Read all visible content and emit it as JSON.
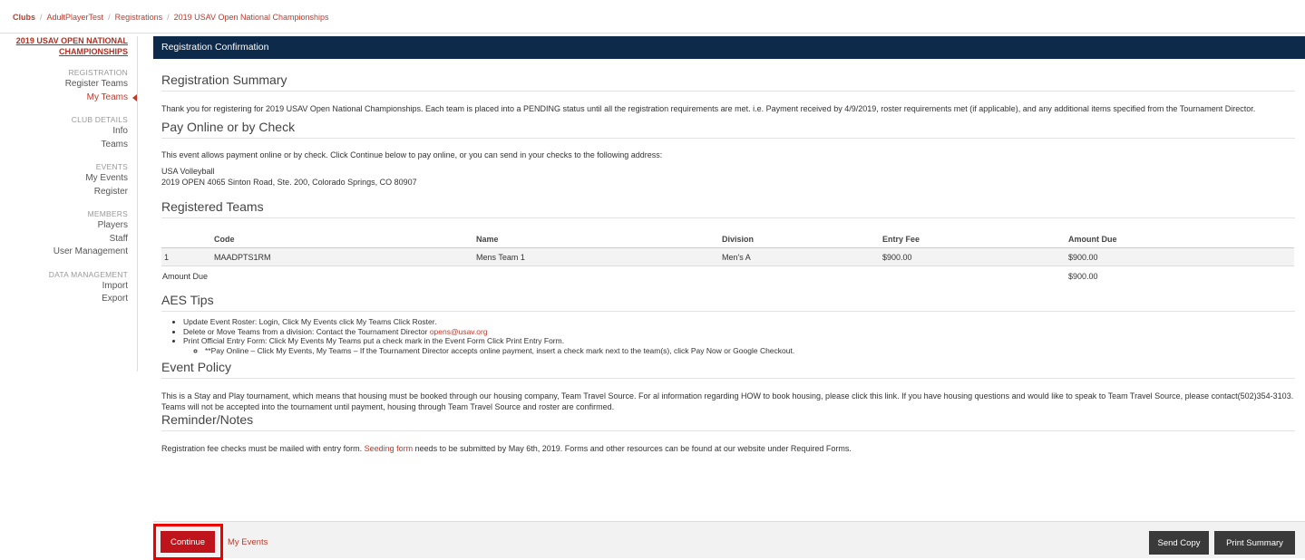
{
  "breadcrumb": [
    "Clubs",
    "AdultPlayerTest",
    "Registrations",
    "2019 USAV Open National Championships"
  ],
  "sidebar": {
    "event_title": "2019 USAV OPEN NATIONAL CHAMPIONSHIPS",
    "sections": [
      {
        "title": "REGISTRATION",
        "items": [
          "Register Teams",
          "My Teams"
        ]
      },
      {
        "title": "CLUB DETAILS",
        "items": [
          "Info",
          "Teams"
        ]
      },
      {
        "title": "EVENTS",
        "items": [
          "My Events",
          "Register"
        ]
      },
      {
        "title": "MEMBERS",
        "items": [
          "Players",
          "Staff",
          "User Management"
        ]
      },
      {
        "title": "DATA MANAGEMENT",
        "items": [
          "Import",
          "Export"
        ]
      }
    ]
  },
  "panel": {
    "title": "Registration Confirmation"
  },
  "summary": {
    "heading": "Registration Summary",
    "text": "Thank you for registering for 2019 USAV Open National Championships. Each team is placed into a PENDING status until all the registration requirements are met. i.e. Payment received by 4/9/2019, roster requirements met (if applicable), and any additional items specified from the Tournament Director."
  },
  "pay": {
    "heading": "Pay Online or by Check",
    "text": "This event allows payment online or by check. Click Continue below to pay online, or you can send in your checks to the following address:",
    "address_line1": "USA Volleyball",
    "address_line2": "2019 OPEN 4065 Sinton Road, Ste. 200, Colorado Springs, CO 80907"
  },
  "teams": {
    "heading": "Registered Teams",
    "columns": [
      "Code",
      "Name",
      "Division",
      "Entry Fee",
      "Amount Due"
    ],
    "rows": [
      {
        "index": "1",
        "code": "MAADPTS1RM",
        "name": "Mens Team 1",
        "division": "Men's A",
        "fee": "$900.00",
        "due": "$900.00"
      }
    ],
    "total_label": "Amount Due",
    "total_value": "$900.00"
  },
  "tips": {
    "heading": "AES Tips",
    "item1": "Update Event Roster: Login, Click My Events click My Teams Click Roster.",
    "item2_prefix": "Delete or Move Teams from a division: Contact the Tournament Director ",
    "item2_email": "opens@usav.org",
    "item3": "Print Official Entry Form: Click My Events My Teams put a check mark in the Event Form Click Print Entry Form.",
    "item3_sub": "**Pay Online – Click My Events, My Teams – If the Tournament Director accepts online payment, insert a check mark next to the team(s), click Pay Now or Google Checkout."
  },
  "policy": {
    "heading": "Event Policy",
    "text": "This is a Stay and Play tournament, which means that housing must be booked through our housing company, Team Travel Source. For al information regarding HOW to book housing, please click this link. If you have housing questions and would like to speak to Team Travel Source, please contact(502)354-3103. Teams will not be accepted into the tournament until payment, housing through Team Travel Source and roster are confirmed."
  },
  "reminder": {
    "heading": "Reminder/Notes",
    "text_before": "Registration fee checks must be mailed with entry form. ",
    "link": "Seeding form",
    "text_after": " needs to be submitted by May 6th, 2019. Forms and other resources can be found at our website under Required Forms."
  },
  "footer": {
    "continue_label": "Continue",
    "my_events_label": "My Events",
    "send_copy_label": "Send Copy",
    "print_summary_label": "Print Summary"
  }
}
